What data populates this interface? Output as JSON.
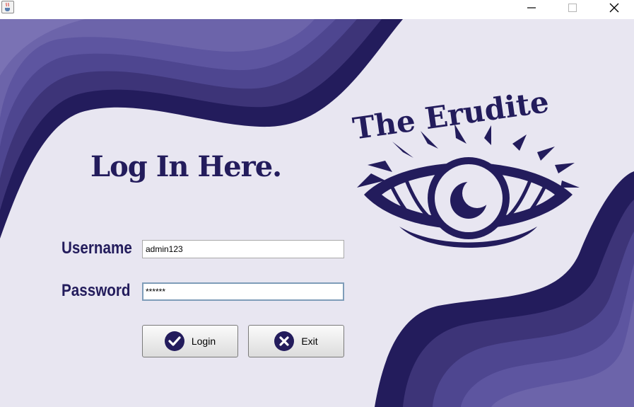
{
  "window": {
    "icon": "java-coffee-icon",
    "controls": [
      "minimize-icon",
      "maximize-icon",
      "close-icon"
    ]
  },
  "brand": {
    "logo_text": "The Erudite",
    "logo_icon": "eye-moon-icon"
  },
  "login": {
    "heading": "Log In Here.",
    "username_label": "Username",
    "username_value": "admin123",
    "password_label": "Password",
    "password_value": "******",
    "login_button": "Login",
    "login_icon": "check-circle-icon",
    "exit_button": "Exit",
    "exit_icon": "x-circle-icon"
  },
  "colors": {
    "primary": "#231c5c",
    "background": "#e8e6f1",
    "wave_light": "#6f66a0",
    "wave_mid": "#4b4287"
  }
}
